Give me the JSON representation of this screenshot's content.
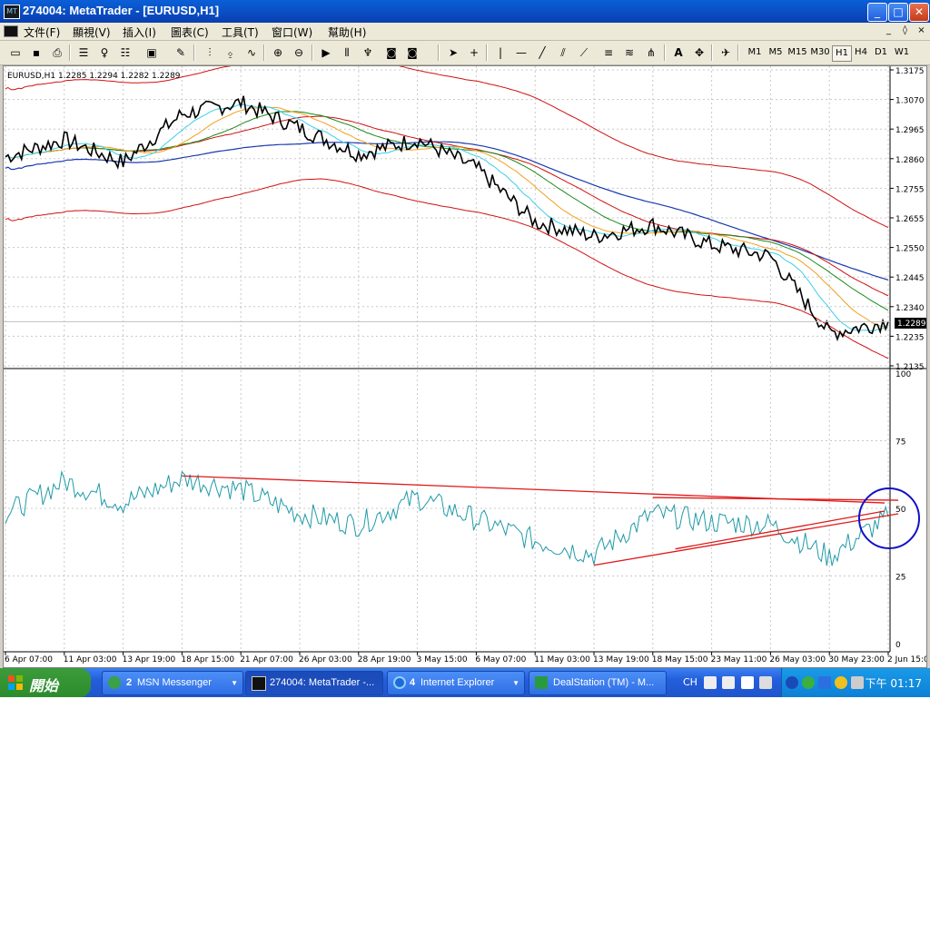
{
  "window": {
    "title": "274004: MetaTrader - [EURUSD,H1]",
    "buttons": {
      "minimize": "_",
      "maximize": "□",
      "close": "✕"
    }
  },
  "menubar": {
    "items": [
      "文件(F)",
      "顯視(V)",
      "插入(I)",
      "圖表(C)",
      "工具(T)",
      "窗口(W)",
      "幫助(H)"
    ],
    "mdi_buttons": [
      "_",
      "◊",
      "×"
    ]
  },
  "toolbar": {
    "timeframes": [
      "M1",
      "M5",
      "M15",
      "M30",
      "H1",
      "H4",
      "D1",
      "W1"
    ],
    "active_timeframe": "H1",
    "text_tool": "A"
  },
  "chart": {
    "symbol_info": "EURUSD,H1  1.2285 1.2294 1.2282 1.2289",
    "current_price": "1.2289",
    "price_axis": [
      "1.3175",
      "1.3070",
      "1.2965",
      "1.2860",
      "1.2755",
      "1.2655",
      "1.2550",
      "1.2445",
      "1.2340",
      "1.2235",
      "1.2135"
    ],
    "oscillator_axis": [
      "100",
      "75",
      "50",
      "25",
      "0"
    ],
    "time_axis": [
      "6 Apr 07:00",
      "11 Apr 03:00",
      "13 Apr 19:00",
      "18 Apr 15:00",
      "21 Apr 07:00",
      "26 Apr 03:00",
      "28 Apr 19:00",
      "3 May 15:00",
      "6 May 07:00",
      "11 May 03:00",
      "13 May 19:00",
      "18 May 15:00",
      "23 May 11:00",
      "26 May 03:00",
      "30 May 23:00",
      "2 Jun 15:00"
    ],
    "colors": {
      "price": "#000000",
      "ma_cyan": "#3ad0e8",
      "ma_orange": "#f0a020",
      "ma_green": "#1a8a1a",
      "envelope_red": "#d01010",
      "ma_blue": "#1a3ab0",
      "oscillator": "#1f9aa8",
      "trendline": "#e01818",
      "circle": "#1010c8",
      "grid": "#c8c8c8"
    }
  },
  "chart_data": {
    "type": "line",
    "title": "EURUSD,H1",
    "x": [
      "6 Apr 07:00",
      "11 Apr 03:00",
      "13 Apr 19:00",
      "18 Apr 15:00",
      "21 Apr 07:00",
      "26 Apr 03:00",
      "28 Apr 19:00",
      "3 May 15:00",
      "6 May 07:00",
      "11 May 03:00",
      "13 May 19:00",
      "18 May 15:00",
      "23 May 11:00",
      "26 May 03:00",
      "30 May 23:00",
      "2 Jun 15:00"
    ],
    "series": [
      {
        "name": "EURUSD",
        "values": [
          1.287,
          1.293,
          1.285,
          1.302,
          1.306,
          1.297,
          1.288,
          1.293,
          1.283,
          1.264,
          1.259,
          1.263,
          1.256,
          1.252,
          1.225,
          1.229
        ]
      }
    ],
    "oscillator": {
      "values": [
        48,
        60,
        52,
        61,
        57,
        48,
        44,
        54,
        46,
        38,
        33,
        48,
        45,
        44,
        32,
        47
      ],
      "ylim": [
        0,
        100
      ]
    },
    "ylim": [
      1.2135,
      1.3175
    ]
  },
  "taskbar": {
    "start_label": "開始",
    "tasks": [
      {
        "count": "2",
        "label": "MSN Messenger"
      },
      {
        "count": "",
        "label": "274004: MetaTrader -..."
      },
      {
        "count": "4",
        "label": "Internet Explorer"
      },
      {
        "count": "",
        "label": "DealStation (TM) - M..."
      }
    ],
    "tray": {
      "lang": "CH",
      "clock": "下午 01:17"
    }
  }
}
